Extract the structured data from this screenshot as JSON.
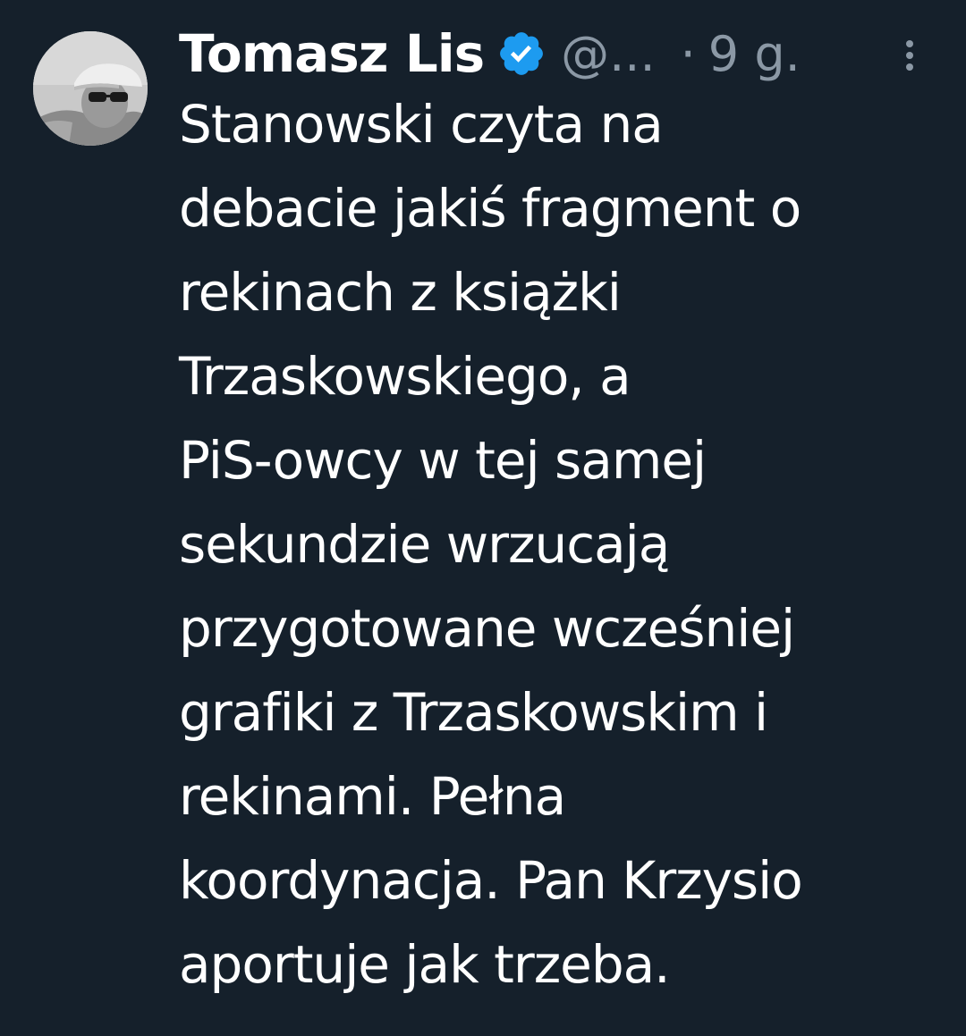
{
  "author": {
    "name": "Tomasz Lis",
    "handle": "@...",
    "separator": "·",
    "time": "9 g.",
    "verified_color": "#1d9bf0"
  },
  "tweet": {
    "lines": [
      "Stanowski czyta na",
      "debacie jakiś fragment o",
      "rekinach z książki",
      "Trzaskowskiego, a",
      "PiS-owcy w tej samej",
      "sekundzie wrzucają",
      "przygotowane wcześniej",
      "grafiki z Trzaskowskim i",
      "rekinami. Pełna",
      "koordynacja. Pan Krzysio",
      "aportuje jak trzeba."
    ]
  },
  "icons": {
    "verified": "verified-badge-icon",
    "more": "more-options-icon"
  },
  "colors": {
    "background": "#15202b",
    "text": "#ffffff",
    "secondary_text": "#8b98a5"
  }
}
